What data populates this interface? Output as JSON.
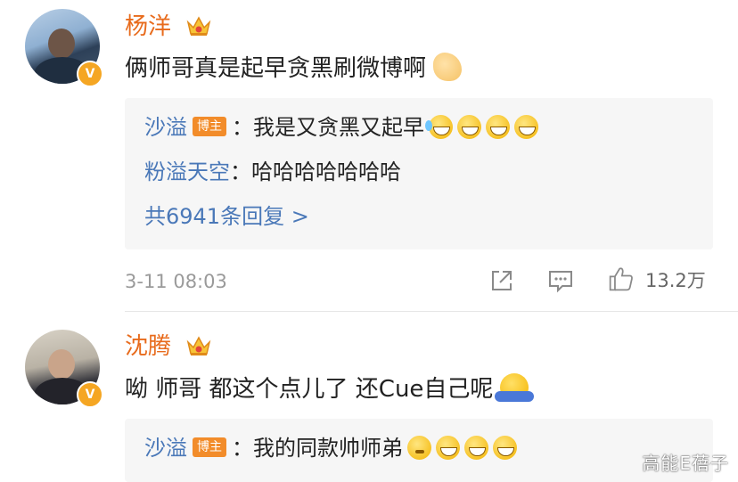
{
  "comments": [
    {
      "username": "杨洋",
      "text": "俩师哥真是起早贪黑刷微博啊",
      "text_emoji": "ok-hand-emoji",
      "replies": [
        {
          "name": "沙溢",
          "badge": "博主",
          "sep": "：",
          "text": "我是又贪黑又起早"
        },
        {
          "name": "粉溢天空",
          "sep": "：",
          "text": "哈哈哈哈哈哈哈"
        }
      ],
      "more_replies": "共6941条回复 >",
      "timestamp": "3-11 08:03",
      "likes": "13.2万"
    },
    {
      "username": "沈腾",
      "text": "呦 师哥 都这个点儿了 还Cue自己呢",
      "text_emoji": "shrug-emoji",
      "replies": [
        {
          "name": "沙溢",
          "badge": "博主",
          "sep": "：",
          "text": "我的同款帅师弟"
        }
      ]
    }
  ],
  "watermark": "高能E蓓子",
  "colors": {
    "username": "#e86b1c",
    "link": "#4a78b8",
    "badge": "#f28c2a",
    "verified": "#f5a623"
  },
  "icons": [
    "share-icon",
    "comment-icon",
    "like-icon",
    "crown-icon",
    "verified-icon"
  ]
}
